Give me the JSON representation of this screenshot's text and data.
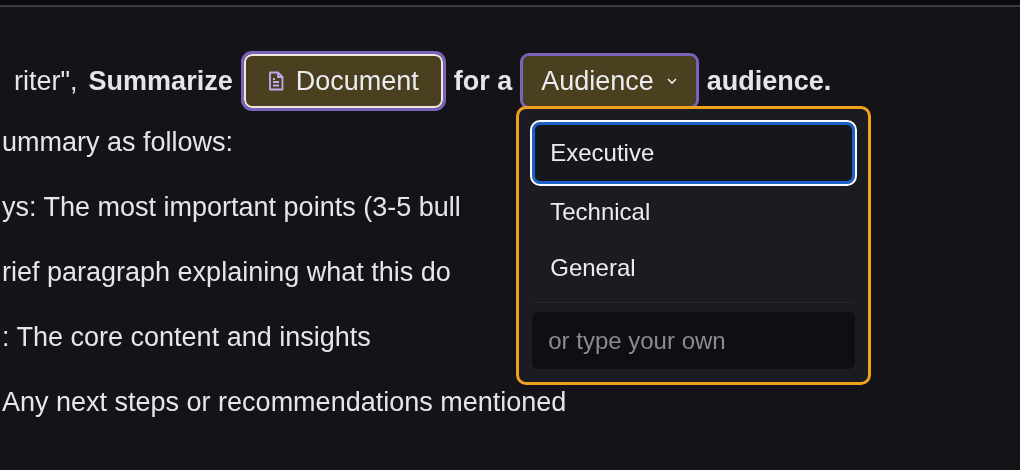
{
  "prompt": [
    {
      "segments": [
        {
          "kind": "text",
          "text": "riter\","
        },
        {
          "kind": "bold",
          "text": "Summarize"
        },
        {
          "kind": "chip",
          "text": "Document"
        },
        {
          "kind": "bold",
          "text": "for a"
        },
        {
          "kind": "select",
          "text": "Audience",
          "expanded": true
        },
        {
          "kind": "bold",
          "text": "audience."
        }
      ]
    },
    {
      "segments": [
        {
          "kind": "text",
          "text": "ummary as follows:"
        }
      ]
    },
    {
      "segments": [
        {
          "kind": "text",
          "text": "ys: The most important points (3-5 bull"
        }
      ]
    },
    {
      "segments": [
        {
          "kind": "text",
          "text": "rief paragraph explaining what this do"
        }
      ]
    },
    {
      "segments": [
        {
          "kind": "text",
          "text": ": The core content and insights"
        }
      ]
    },
    {
      "segments": [
        {
          "kind": "text",
          "text": "Any next steps or recommendations mentioned"
        }
      ]
    }
  ],
  "audience_menu": {
    "options": [
      {
        "label": "Executive",
        "selected": true
      },
      {
        "label": "Technical",
        "selected": false
      },
      {
        "label": "General",
        "selected": false
      }
    ],
    "custom": {
      "placeholder": "or type your own"
    }
  }
}
